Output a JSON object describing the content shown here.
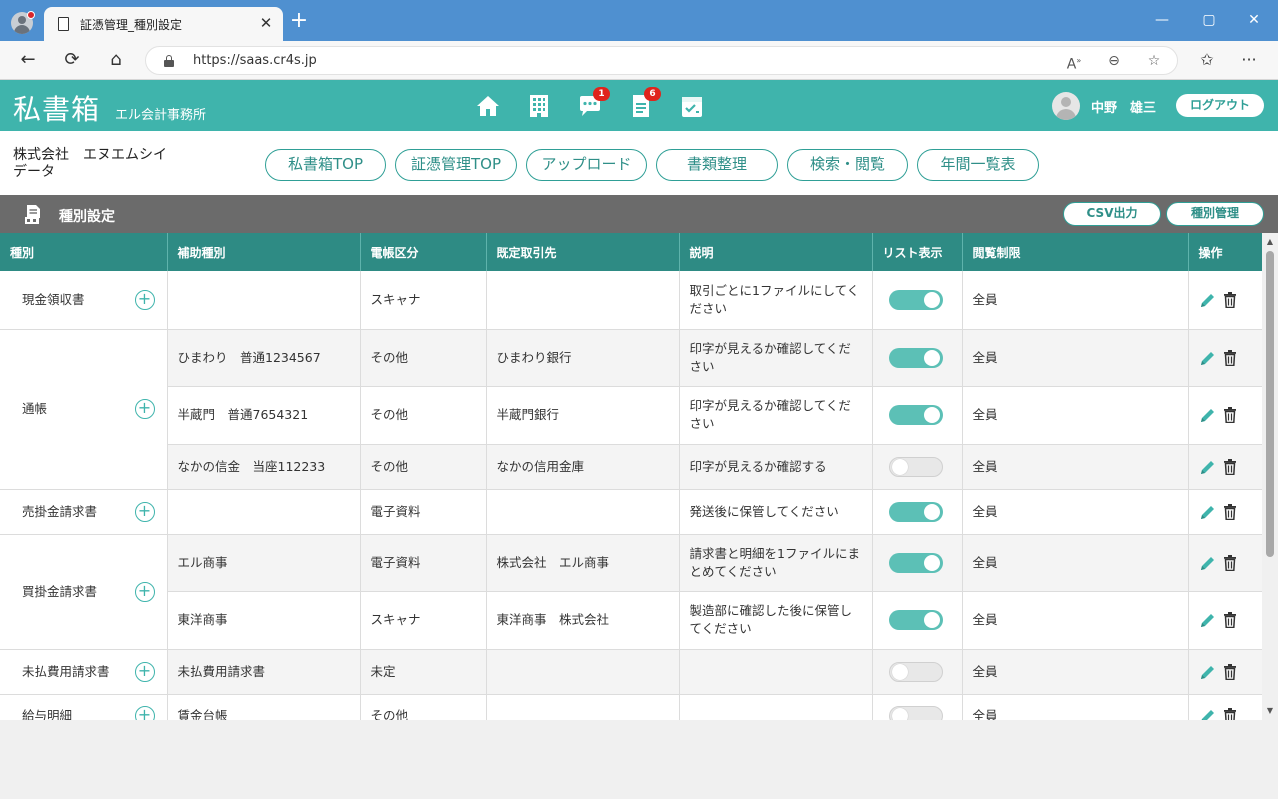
{
  "browser": {
    "tab_title": "証憑管理_種別設定",
    "url": "https://saas.cr4s.jp",
    "new_tab_symbol": "+",
    "close_symbol": "✕"
  },
  "header": {
    "logo": "私書箱",
    "office": "エル会計事務所",
    "chat_badge": "1",
    "doc_badge": "6",
    "user_name": "中野　雄三",
    "logout": "ログアウト"
  },
  "company": "株式会社　エヌエムシイデータ",
  "nav": [
    "私書箱TOP",
    "証憑管理TOP",
    "アップロード",
    "書類整理",
    "検索・閲覧",
    "年間一覧表"
  ],
  "section": {
    "title": "種別設定",
    "csv_button": "CSV出力",
    "type_manage_button": "種別管理"
  },
  "table": {
    "headers": [
      "種別",
      "補助種別",
      "電帳区分",
      "既定取引先",
      "説明",
      "リスト表示",
      "閲覧制限",
      "操作"
    ],
    "groups": [
      {
        "category": "現金領収書",
        "rows": [
          {
            "sub": "",
            "kubun": "スキャナ",
            "partner": "",
            "desc": "取引ごとに1ファイルにしてください",
            "list": true,
            "access": "全員"
          }
        ]
      },
      {
        "category": "通帳",
        "rows": [
          {
            "sub": "ひまわり　普通1234567",
            "kubun": "その他",
            "partner": "ひまわり銀行",
            "desc": "印字が見えるか確認してください",
            "list": true,
            "access": "全員"
          },
          {
            "sub": "半蔵門　普通7654321",
            "kubun": "その他",
            "partner": "半蔵門銀行",
            "desc": "印字が見えるか確認してください",
            "list": true,
            "access": "全員"
          },
          {
            "sub": "なかの信金　当座112233",
            "kubun": "その他",
            "partner": "なかの信用金庫",
            "desc": "印字が見えるか確認する",
            "list": false,
            "access": "全員"
          }
        ]
      },
      {
        "category": "売掛金請求書",
        "rows": [
          {
            "sub": "",
            "kubun": "電子資料",
            "partner": "",
            "desc": "発送後に保管してください",
            "list": true,
            "access": "全員"
          }
        ]
      },
      {
        "category": "買掛金請求書",
        "rows": [
          {
            "sub": "エル商事",
            "kubun": "電子資料",
            "partner": "株式会社　エル商事",
            "desc": "請求書と明細を1ファイルにまとめてください",
            "list": true,
            "access": "全員"
          },
          {
            "sub": "東洋商事",
            "kubun": "スキャナ",
            "partner": "東洋商事　株式会社",
            "desc": "製造部に確認した後に保管してください",
            "list": true,
            "access": "全員"
          }
        ]
      },
      {
        "category": "未払費用請求書",
        "rows": [
          {
            "sub": "未払費用請求書",
            "kubun": "未定",
            "partner": "",
            "desc": "",
            "list": false,
            "access": "全員"
          }
        ]
      },
      {
        "category": "給与明細",
        "rows": [
          {
            "sub": "賃金台帳",
            "kubun": "その他",
            "partner": "",
            "desc": "",
            "list": false,
            "access": "全員"
          }
        ]
      }
    ]
  },
  "colors": {
    "teal": "#3fb4ac",
    "header_teal": "#2e8b84",
    "section_gray": "#6b6b6b",
    "badge_red": "#e0241c"
  }
}
